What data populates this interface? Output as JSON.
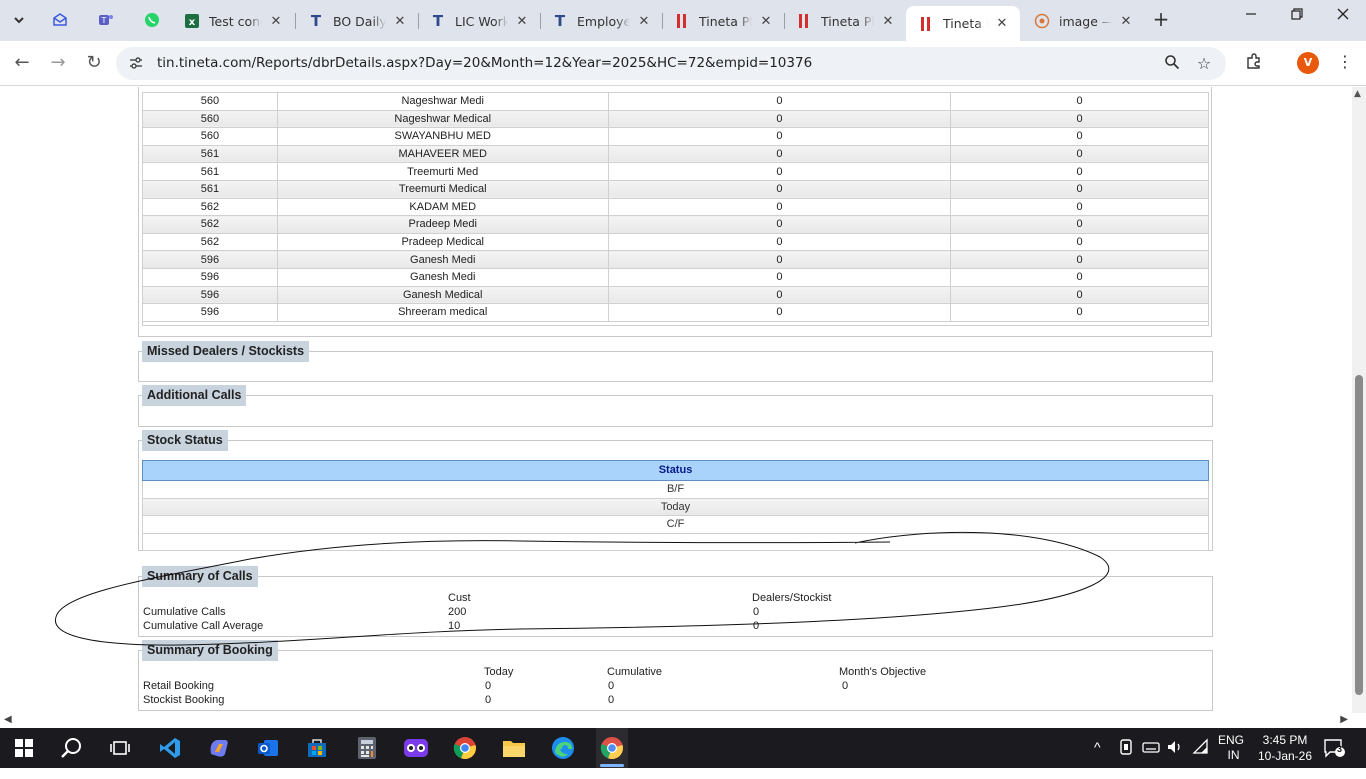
{
  "browser": {
    "tabs": [
      {
        "title": "",
        "icon": "outlook-icon"
      },
      {
        "title": "",
        "icon": "teams-icon"
      },
      {
        "title": "",
        "icon": "whatsapp-icon"
      },
      {
        "title": "Test cond",
        "icon": "excel-icon"
      },
      {
        "title": "BO Daily",
        "icon": "tineta-t-icon"
      },
      {
        "title": "LIC Work",
        "icon": "tineta-t-icon"
      },
      {
        "title": "Employee",
        "icon": "tineta-t-icon"
      },
      {
        "title": "Tineta Ph",
        "icon": "tineta-bars-icon"
      },
      {
        "title": "Tineta Ph",
        "icon": "tineta-bars-icon"
      },
      {
        "title": "Tineta Ph",
        "icon": "tineta-bars-icon",
        "active": true
      },
      {
        "title": "image —",
        "icon": "image-icon"
      }
    ],
    "url": "tin.tineta.com/Reports/dbrDetails.aspx?Day=20&Month=12&Year=2025&HC=72&empid=10376",
    "profile_initial": "V"
  },
  "dealer_rows": [
    {
      "code": "560",
      "name": "Nageshwar Medi",
      "v1": "0",
      "v2": "0"
    },
    {
      "code": "560",
      "name": "Nageshwar Medical",
      "v1": "0",
      "v2": "0"
    },
    {
      "code": "560",
      "name": "SWAYANBHU MED",
      "v1": "0",
      "v2": "0"
    },
    {
      "code": "561",
      "name": "MAHAVEER MED",
      "v1": "0",
      "v2": "0"
    },
    {
      "code": "561",
      "name": "Treemurti Med",
      "v1": "0",
      "v2": "0"
    },
    {
      "code": "561",
      "name": "Treemurti Medical",
      "v1": "0",
      "v2": "0"
    },
    {
      "code": "562",
      "name": "KADAM MED",
      "v1": "0",
      "v2": "0"
    },
    {
      "code": "562",
      "name": "Pradeep Medi",
      "v1": "0",
      "v2": "0"
    },
    {
      "code": "562",
      "name": "Pradeep Medical",
      "v1": "0",
      "v2": "0"
    },
    {
      "code": "596",
      "name": "Ganesh Medi",
      "v1": "0",
      "v2": "0"
    },
    {
      "code": "596",
      "name": "Ganesh Medi",
      "v1": "0",
      "v2": "0"
    },
    {
      "code": "596",
      "name": "Ganesh Medical",
      "v1": "0",
      "v2": "0"
    },
    {
      "code": "596",
      "name": "Shreeram medical",
      "v1": "0",
      "v2": "0"
    }
  ],
  "sections": {
    "missed": "Missed Dealers / Stockists",
    "additional": "Additional Calls",
    "stock": "Stock Status",
    "summary_calls": "Summary of Calls",
    "summary_booking": "Summary of Booking"
  },
  "stock_status": {
    "header": "Status",
    "rows": [
      "B/F",
      "Today",
      "C/F",
      ""
    ]
  },
  "summary_calls": {
    "col_cust": "Cust",
    "col_dealers": "Dealers/Stockist",
    "rows": [
      {
        "label": "Cumulative Calls",
        "cust": "200",
        "dealers": "0"
      },
      {
        "label": "Cumulative Call Average",
        "cust": "10",
        "dealers": "0"
      }
    ]
  },
  "summary_booking": {
    "col_today": "Today",
    "col_cumulative": "Cumulative",
    "col_objective": "Month's Objective",
    "rows": [
      {
        "label": "Retail Booking",
        "today": "0",
        "cumulative": "0",
        "objective": "0"
      },
      {
        "label": "Stockist Booking",
        "today": "0",
        "cumulative": "0",
        "objective": ""
      }
    ]
  },
  "taskbar": {
    "lang": "ENG",
    "region": "IN",
    "time": "3:45 PM",
    "date": "10-Jan-26",
    "notifications": "3"
  },
  "colors": {
    "status_header_bg": "#a9d3fb",
    "legend_bg": "#c9d3de",
    "tineta_red": "#d32f2f"
  }
}
